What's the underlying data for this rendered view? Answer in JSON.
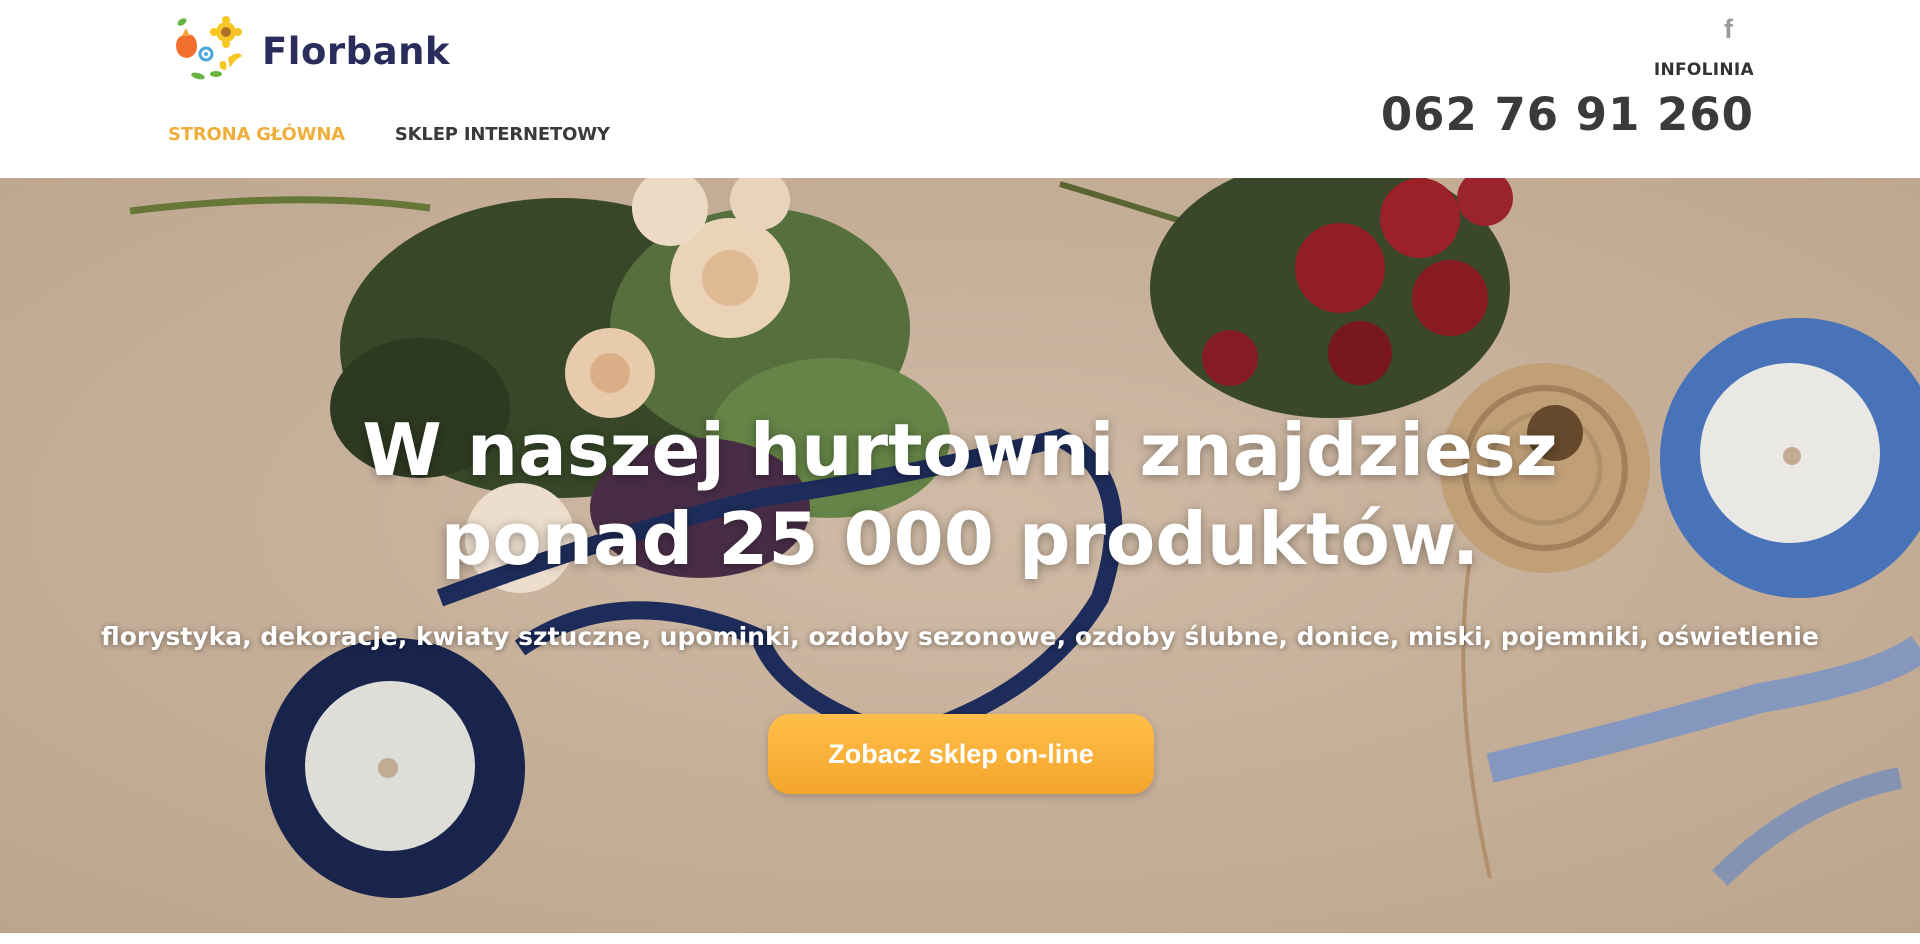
{
  "brand": {
    "name": "Florbank"
  },
  "nav": {
    "items": [
      {
        "label": "STRONA GŁÓWNA",
        "active": true
      },
      {
        "label": "SKLEP INTERNETOWY",
        "active": false
      }
    ]
  },
  "contact": {
    "facebook_glyph": "f",
    "infoline_label": "INFOLINIA",
    "phone": "062 76 91 260"
  },
  "hero": {
    "headline_line1": "W naszej hurtowni znajdziesz",
    "headline_line2": "ponad 25 000 produktów.",
    "subline": "florystyka, dekoracje, kwiaty sztuczne, upominki, ozdoby sezonowe, ozdoby ślubne, donice, miski, pojemniki, oświetlenie",
    "cta_label": "Zobacz sklep on-line"
  },
  "colors": {
    "accent": "#f0ae3c",
    "brand_text": "#2a2d5c",
    "cta_top": "#ffbf4a",
    "cta_bottom": "#f4a52b"
  }
}
